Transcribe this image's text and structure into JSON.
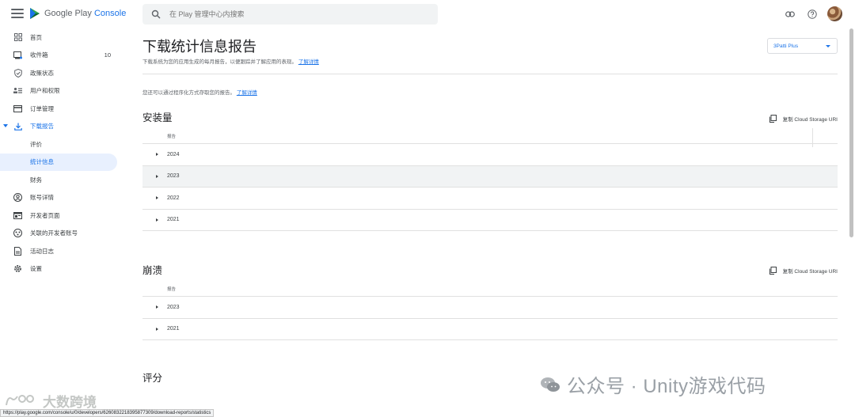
{
  "header": {
    "logo_text_1": "Google Play ",
    "logo_text_2": "Console",
    "search_placeholder": "在 Play 管理中心内搜索",
    "icons": [
      "menu-icon",
      "link-icon",
      "help-icon",
      "avatar"
    ]
  },
  "sidebar": {
    "items": [
      {
        "label": "首页",
        "icon": "dashboard-icon"
      },
      {
        "label": "收件箱",
        "icon": "inbox-icon",
        "count": "10"
      },
      {
        "label": "政策状态",
        "icon": "shield-check-icon"
      },
      {
        "label": "用户和权限",
        "icon": "people-icon"
      },
      {
        "label": "订单管理",
        "icon": "credit-card-icon"
      },
      {
        "label": "下载报告",
        "icon": "download-icon"
      },
      {
        "label": "评价"
      },
      {
        "label": "统计信息"
      },
      {
        "label": "财务"
      },
      {
        "label": "账号详情",
        "icon": "account-icon"
      },
      {
        "label": "开发者页面",
        "icon": "web-page-icon"
      },
      {
        "label": "关联的开发者账号",
        "icon": "linked-accounts-icon"
      },
      {
        "label": "活动日志",
        "icon": "log-icon"
      },
      {
        "label": "设置",
        "icon": "gear-icon"
      }
    ]
  },
  "main": {
    "title": "下载统计信息报告",
    "description": "下载系统为您的应用生成的每月报告，以便跟踪并了解应用的表现。",
    "description_link": "了解详情",
    "app_selector": "3Patti Plus",
    "api_note": "您还可以通过程序化方式存取您的报告。",
    "api_note_link": "了解详情",
    "copy_uri_label": "复制 Cloud Storage URI",
    "column_header": "报告",
    "sections": [
      {
        "title": "安装量",
        "rows": [
          "2024",
          "2023",
          "2022",
          "2021"
        ]
      },
      {
        "title": "崩溃",
        "rows": [
          "2023",
          "2021"
        ]
      },
      {
        "title": "评分"
      }
    ]
  },
  "overlay": {
    "watermark": "公众号 · Unity游戏代码",
    "watermark2": "大数跨境",
    "status_url": "https://play.google.com/console/u/0/developers/6260832218395877309/download-reports/statistics"
  },
  "colors": {
    "accent": "#1a73e8",
    "active_bg": "#e8f0fe",
    "hover_row": "#f1f3f4",
    "divider": "#e0e0e0"
  }
}
